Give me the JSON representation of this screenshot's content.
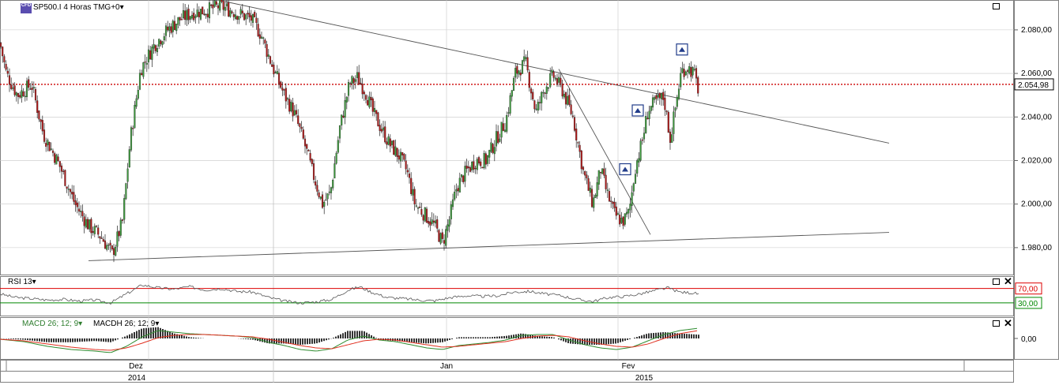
{
  "header": {
    "symbol": "SP500.I",
    "timeframe": "4 Horas",
    "timezone": "TMG+0",
    "title": "SP500.I 4 Horas TMG+0",
    "dropdown_glyph": "▾",
    "symbol_badge_icon": "cfd-badge-icon"
  },
  "price_pane": {
    "last_price_label": "2.054,98",
    "y_ticks": [
      "2.080,00",
      "2.060,00",
      "2.040,00",
      "2.020,00",
      "2.000,00",
      "1.980,00"
    ],
    "maximize_icon": "maximize-icon"
  },
  "rsi_pane": {
    "label": "RSI 13",
    "levels": [
      "70,00",
      "30,00"
    ],
    "icons": [
      "maximize-icon",
      "close-icon"
    ]
  },
  "macd_pane": {
    "label_macd": "MACD 26; 12; 9",
    "label_macdh": "MACDH 26; 12; 9",
    "zero_label": "0,00",
    "icons": [
      "maximize-icon",
      "close-icon"
    ]
  },
  "time_axis": {
    "months": [
      "Dez",
      "Jan",
      "Fev"
    ],
    "years": [
      "2014",
      "2015"
    ]
  },
  "colors": {
    "bull": "#3d9a3d",
    "bear": "#b01818",
    "last_price_line": "#cc0000",
    "rsi_upper": "#dd0000",
    "rsi_lower": "#008800",
    "macd": "#2e8b2e",
    "signal": "#e03020",
    "grid": "#c8c8c8"
  },
  "chart_data": {
    "type": "candlestick",
    "title": "SP500.I 4 Horas TMG+0",
    "ylim": [
      1968,
      2093
    ],
    "last_price": 2054.98,
    "close_path": [
      [
        0,
        2074
      ],
      [
        8,
        2060
      ],
      [
        22,
        2050
      ],
      [
        40,
        2055
      ],
      [
        55,
        2032
      ],
      [
        75,
        2018
      ],
      [
        95,
        2000
      ],
      [
        112,
        1990
      ],
      [
        128,
        1985
      ],
      [
        142,
        1977
      ],
      [
        155,
        1992
      ],
      [
        165,
        2030
      ],
      [
        178,
        2062
      ],
      [
        195,
        2073
      ],
      [
        212,
        2080
      ],
      [
        228,
        2085
      ],
      [
        245,
        2088
      ],
      [
        262,
        2089
      ],
      [
        278,
        2091
      ],
      [
        292,
        2089
      ],
      [
        305,
        2087
      ],
      [
        318,
        2085
      ],
      [
        330,
        2078
      ],
      [
        338,
        2070
      ],
      [
        348,
        2060
      ],
      [
        360,
        2050
      ],
      [
        372,
        2042
      ],
      [
        385,
        2028
      ],
      [
        395,
        2015
      ],
      [
        408,
        2000
      ],
      [
        418,
        2005
      ],
      [
        430,
        2035
      ],
      [
        442,
        2055
      ],
      [
        452,
        2058
      ],
      [
        462,
        2052
      ],
      [
        472,
        2042
      ],
      [
        482,
        2035
      ],
      [
        492,
        2028
      ],
      [
        505,
        2022
      ],
      [
        515,
        2015
      ],
      [
        525,
        2000
      ],
      [
        538,
        1995
      ],
      [
        550,
        1990
      ],
      [
        560,
        1982
      ],
      [
        568,
        1992
      ],
      [
        578,
        2008
      ],
      [
        590,
        2015
      ],
      [
        602,
        2020
      ],
      [
        615,
        2020
      ],
      [
        628,
        2030
      ],
      [
        640,
        2038
      ],
      [
        652,
        2060
      ],
      [
        665,
        2065
      ],
      [
        678,
        2042
      ],
      [
        690,
        2054
      ],
      [
        700,
        2059
      ],
      [
        712,
        2052
      ],
      [
        725,
        2040
      ],
      [
        738,
        2015
      ],
      [
        750,
        2000
      ],
      [
        760,
        2016
      ],
      [
        768,
        2005
      ],
      [
        778,
        1995
      ],
      [
        788,
        1992
      ],
      [
        796,
        1996
      ],
      [
        804,
        2017
      ],
      [
        812,
        2028
      ],
      [
        820,
        2043
      ],
      [
        830,
        2047
      ],
      [
        840,
        2049
      ],
      [
        848,
        2030
      ],
      [
        855,
        2045
      ],
      [
        862,
        2061
      ],
      [
        870,
        2063
      ],
      [
        878,
        2060
      ],
      [
        884,
        2052
      ]
    ],
    "trendlines": [
      {
        "from": [
          285,
          2093
        ],
        "to": [
          1125,
          2028
        ]
      },
      {
        "from": [
          112,
          1974
        ],
        "to": [
          1125,
          1987
        ]
      },
      {
        "from": [
          707,
          2062
        ],
        "to": [
          823,
          1986
        ]
      }
    ],
    "signal_markers": [
      [
        863,
        2071
      ],
      [
        807,
        2043
      ],
      [
        791,
        2016
      ]
    ],
    "rsi": {
      "period": 13,
      "levels": [
        70,
        30
      ],
      "path": [
        [
          0,
          55
        ],
        [
          20,
          45
        ],
        [
          40,
          42
        ],
        [
          60,
          38
        ],
        [
          80,
          40
        ],
        [
          100,
          35
        ],
        [
          120,
          38
        ],
        [
          140,
          30
        ],
        [
          160,
          55
        ],
        [
          180,
          80
        ],
        [
          200,
          72
        ],
        [
          220,
          68
        ],
        [
          240,
          75
        ],
        [
          260,
          66
        ],
        [
          280,
          70
        ],
        [
          300,
          62
        ],
        [
          320,
          60
        ],
        [
          340,
          45
        ],
        [
          360,
          35
        ],
        [
          380,
          30
        ],
        [
          400,
          33
        ],
        [
          420,
          40
        ],
        [
          440,
          65
        ],
        [
          455,
          75
        ],
        [
          470,
          60
        ],
        [
          490,
          45
        ],
        [
          510,
          42
        ],
        [
          530,
          38
        ],
        [
          550,
          36
        ],
        [
          570,
          45
        ],
        [
          590,
          50
        ],
        [
          610,
          48
        ],
        [
          630,
          50
        ],
        [
          650,
          60
        ],
        [
          670,
          62
        ],
        [
          690,
          55
        ],
        [
          710,
          50
        ],
        [
          730,
          40
        ],
        [
          750,
          34
        ],
        [
          770,
          45
        ],
        [
          790,
          48
        ],
        [
          810,
          55
        ],
        [
          830,
          65
        ],
        [
          845,
          72
        ],
        [
          860,
          60
        ],
        [
          875,
          58
        ],
        [
          884,
          55
        ]
      ]
    },
    "macd": {
      "params": [
        26,
        12,
        9
      ],
      "zero": 0,
      "macd_path": [
        [
          0,
          -1
        ],
        [
          30,
          -4
        ],
        [
          60,
          -10
        ],
        [
          90,
          -14
        ],
        [
          120,
          -16
        ],
        [
          140,
          -18
        ],
        [
          160,
          -10
        ],
        [
          180,
          2
        ],
        [
          200,
          10
        ],
        [
          220,
          8
        ],
        [
          240,
          6
        ],
        [
          260,
          5
        ],
        [
          280,
          4
        ],
        [
          300,
          3
        ],
        [
          320,
          1
        ],
        [
          340,
          -5
        ],
        [
          360,
          -9
        ],
        [
          380,
          -14
        ],
        [
          400,
          -16
        ],
        [
          420,
          -13
        ],
        [
          440,
          -2
        ],
        [
          460,
          3
        ],
        [
          480,
          -2
        ],
        [
          500,
          -4
        ],
        [
          520,
          -8
        ],
        [
          540,
          -12
        ],
        [
          560,
          -14
        ],
        [
          580,
          -9
        ],
        [
          600,
          -7
        ],
        [
          620,
          -5
        ],
        [
          640,
          -2
        ],
        [
          660,
          4
        ],
        [
          680,
          5
        ],
        [
          700,
          5
        ],
        [
          720,
          -2
        ],
        [
          740,
          -8
        ],
        [
          760,
          -12
        ],
        [
          780,
          -14
        ],
        [
          800,
          -11
        ],
        [
          820,
          -3
        ],
        [
          840,
          5
        ],
        [
          860,
          10
        ],
        [
          884,
          13
        ]
      ],
      "signal_path": [
        [
          0,
          -1
        ],
        [
          30,
          -3
        ],
        [
          60,
          -7
        ],
        [
          90,
          -11
        ],
        [
          120,
          -14
        ],
        [
          140,
          -15
        ],
        [
          160,
          -12
        ],
        [
          180,
          -6
        ],
        [
          200,
          1
        ],
        [
          220,
          4
        ],
        [
          240,
          5
        ],
        [
          260,
          5
        ],
        [
          280,
          4
        ],
        [
          300,
          3
        ],
        [
          320,
          2
        ],
        [
          340,
          -1
        ],
        [
          360,
          -5
        ],
        [
          380,
          -9
        ],
        [
          400,
          -12
        ],
        [
          420,
          -13
        ],
        [
          440,
          -8
        ],
        [
          460,
          -3
        ],
        [
          480,
          -1
        ],
        [
          500,
          -2
        ],
        [
          520,
          -5
        ],
        [
          540,
          -8
        ],
        [
          560,
          -11
        ],
        [
          580,
          -10
        ],
        [
          600,
          -8
        ],
        [
          620,
          -6
        ],
        [
          640,
          -4
        ],
        [
          660,
          0
        ],
        [
          680,
          3
        ],
        [
          700,
          4
        ],
        [
          720,
          2
        ],
        [
          740,
          -3
        ],
        [
          760,
          -7
        ],
        [
          780,
          -10
        ],
        [
          800,
          -11
        ],
        [
          820,
          -7
        ],
        [
          840,
          0
        ],
        [
          860,
          6
        ],
        [
          884,
          10
        ]
      ]
    }
  }
}
